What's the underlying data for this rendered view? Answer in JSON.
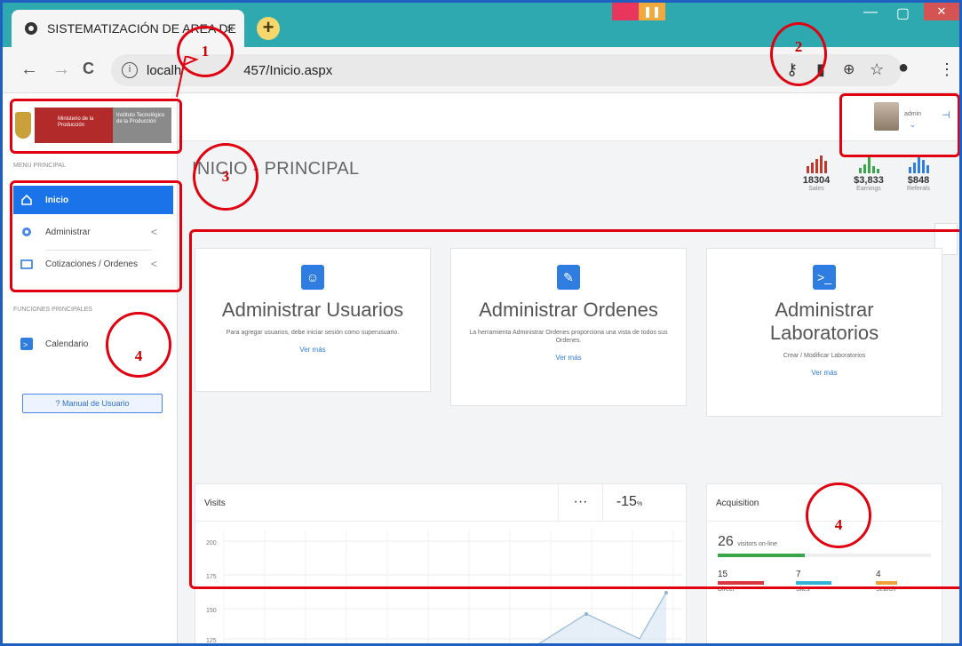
{
  "browser": {
    "tab_title": "SISTEMATIZACIÓN DE AREA DE",
    "tab_close": "×",
    "new_tab": "+",
    "url": "localhost:65457/Inicio.aspx",
    "url_visible_start": "localh",
    "url_visible_end": "457/Inicio.aspx",
    "back": "←",
    "forward": "→",
    "reload": "C",
    "info": "i",
    "icons": [
      "key-icon",
      "extension-icon",
      "zoom-icon",
      "star-icon",
      "account-icon",
      "menu-icon"
    ]
  },
  "sidebar": {
    "logo_text_red": "Ministerio de la Producción",
    "logo_text_grey": "Instituto Tecnológico de la Producción",
    "section_main": "MENU PRINCIPAL",
    "items": [
      {
        "label": "Inicio",
        "icon": "home-icon",
        "active": true
      },
      {
        "label": "Administrar",
        "icon": "gear-icon",
        "chevron": "<"
      },
      {
        "label": "Cotizaciones / Ordenes",
        "icon": "folder-icon",
        "chevron": "<"
      }
    ],
    "section_functions": "FUNCIONES PRINCIPALES",
    "functions": [
      {
        "label": "Calendario",
        "icon": "calendar-icon"
      }
    ],
    "manual_button": "? Manual de Usuario"
  },
  "header": {
    "user_name": "admin",
    "user_chevron": "⌄",
    "toggle": "⊣"
  },
  "main": {
    "title": "INICIO - PRINCIPAL",
    "stats": [
      {
        "value": "18304",
        "label": "Sales",
        "color": "#c0392b"
      },
      {
        "value": "$3,833",
        "label": "Earnings",
        "color": "#3aa54a"
      },
      {
        "value": "$848",
        "label": "Referals",
        "color": "#2f7de1"
      }
    ],
    "cards": [
      {
        "title": "Administrar Usuarios",
        "desc": "Para agregar usuarios, debe iniciar sesión como superusuario.",
        "link": "Ver más",
        "icon": "user-circle-icon"
      },
      {
        "title": "Administrar Ordenes",
        "desc": "La herramienta Administrar Ordenes proporciona una vista de todos sus Ordenes.",
        "link": "Ver más",
        "icon": "paperclip-icon"
      },
      {
        "title": "Administrar Laboratorios",
        "desc": "Crear / Modificar Laboratorios",
        "link": "Ver más",
        "icon": "terminal-icon"
      }
    ],
    "visits": {
      "title": "Visits",
      "more": "···",
      "change_value": "-15",
      "change_unit": "%",
      "y_ticks": [
        "200",
        "175",
        "150",
        "125"
      ]
    },
    "acquisition": {
      "title": "Acquisition",
      "visitors_value": "26",
      "visitors_label": "visitors on-line",
      "online_fraction": 0.41,
      "sources": [
        {
          "value": "15",
          "label": "Direct",
          "color": "#d9363e"
        },
        {
          "value": "7",
          "label": "Sites",
          "color": "#30b3d6"
        },
        {
          "value": "4",
          "label": "Search",
          "color": "#f0a23a"
        }
      ]
    }
  },
  "annotations": [
    "1",
    "2",
    "3",
    "4",
    "4",
    "4"
  ],
  "colors": {
    "accent": "#1a73e8",
    "annotation": "#e0000f",
    "tabstrip": "#2fa9b0"
  }
}
